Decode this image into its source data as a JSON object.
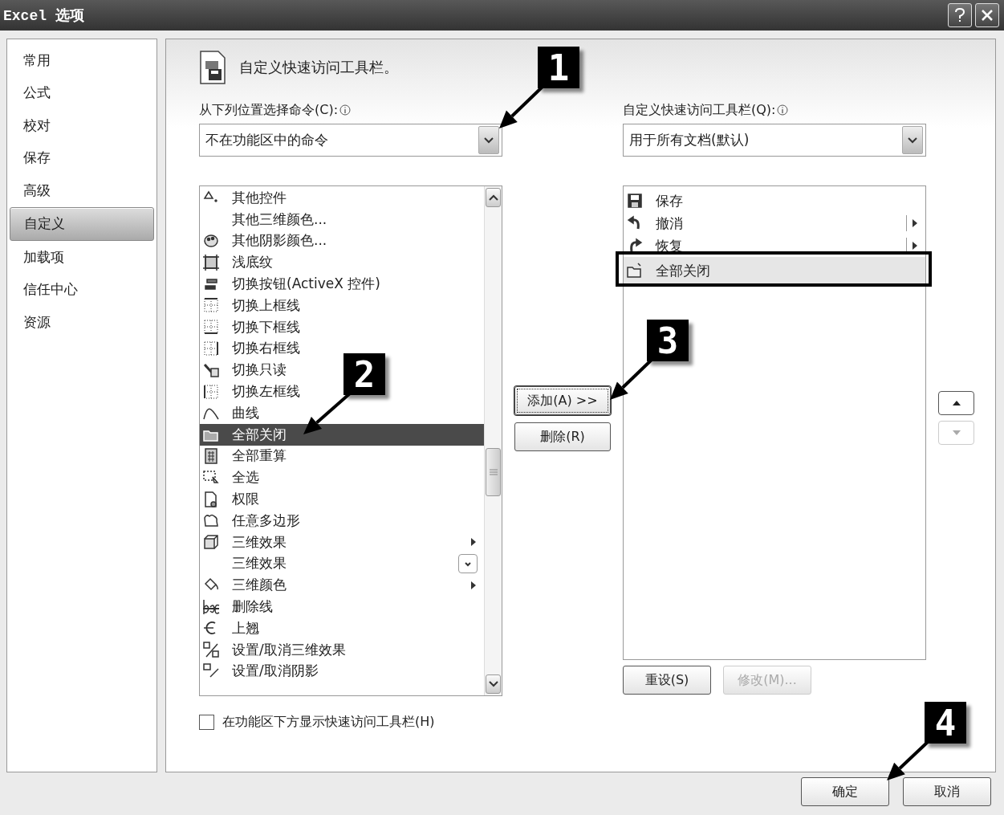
{
  "window": {
    "title": "Excel 选项"
  },
  "sidebar": {
    "items": [
      {
        "label": "常用",
        "selected": false
      },
      {
        "label": "公式",
        "selected": false
      },
      {
        "label": "校对",
        "selected": false
      },
      {
        "label": "保存",
        "selected": false
      },
      {
        "label": "高级",
        "selected": false
      },
      {
        "label": "自定义",
        "selected": true
      },
      {
        "label": "加载项",
        "selected": false
      },
      {
        "label": "信任中心",
        "selected": false
      },
      {
        "label": "资源",
        "selected": false
      }
    ]
  },
  "header": {
    "title": "自定义快速访问工具栏。"
  },
  "commands_source": {
    "label": "从下列位置选择命令(C):",
    "value": "不在功能区中的命令"
  },
  "commands": [
    {
      "label": "其他控件",
      "kind": "plain",
      "selected": false
    },
    {
      "label": "其他三维颜色...",
      "kind": "plain",
      "selected": false
    },
    {
      "label": "其他阴影颜色...",
      "kind": "plain",
      "selected": false
    },
    {
      "label": "浅底纹",
      "kind": "plain",
      "selected": false
    },
    {
      "label": "切换按钮(ActiveX 控件)",
      "kind": "plain",
      "selected": false
    },
    {
      "label": "切换上框线",
      "kind": "plain",
      "selected": false
    },
    {
      "label": "切换下框线",
      "kind": "plain",
      "selected": false
    },
    {
      "label": "切换右框线",
      "kind": "plain",
      "selected": false
    },
    {
      "label": "切换只读",
      "kind": "plain",
      "selected": false
    },
    {
      "label": "切换左框线",
      "kind": "plain",
      "selected": false
    },
    {
      "label": "曲线",
      "kind": "plain",
      "selected": false
    },
    {
      "label": "全部关闭",
      "kind": "plain",
      "selected": true
    },
    {
      "label": "全部重算",
      "kind": "plain",
      "selected": false
    },
    {
      "label": "全选",
      "kind": "plain",
      "selected": false
    },
    {
      "label": "权限",
      "kind": "plain",
      "selected": false
    },
    {
      "label": "任意多边形",
      "kind": "plain",
      "selected": false
    },
    {
      "label": "三维效果",
      "kind": "submenu",
      "selected": false
    },
    {
      "label": "三维效果",
      "kind": "dropdown",
      "selected": false
    },
    {
      "label": "三维颜色",
      "kind": "submenu",
      "selected": false
    },
    {
      "label": "删除线",
      "kind": "plain",
      "selected": false
    },
    {
      "label": "上翘",
      "kind": "plain",
      "selected": false
    },
    {
      "label": "设置/取消三维效果",
      "kind": "plain",
      "selected": false
    },
    {
      "label": "设置/取消阴影",
      "kind": "plain",
      "selected": false
    }
  ],
  "show_below": {
    "label": "在功能区下方显示快速访问工具栏(H)",
    "checked": false
  },
  "middle_buttons": [
    {
      "label": "添加(A) >>",
      "focused": true
    },
    {
      "label": "删除(R)",
      "focused": false
    }
  ],
  "toolbar_target": {
    "label": "自定义快速访问工具栏(Q):",
    "value": "用于所有文档(默认)"
  },
  "toolbar_items": [
    {
      "label": "保存",
      "kind": "plain",
      "selected": false
    },
    {
      "label": "撤消",
      "kind": "submenu",
      "selected": false
    },
    {
      "label": "恢复",
      "kind": "submenu",
      "selected": false
    },
    {
      "label": "全部关闭",
      "kind": "plain",
      "selected": true
    }
  ],
  "list_buttons": [
    {
      "label": "重设(S)",
      "disabled": false
    },
    {
      "label": "修改(M)...",
      "disabled": true
    }
  ],
  "move_buttons": [
    {
      "kind": "up",
      "disabled": false
    },
    {
      "kind": "down",
      "disabled": true
    }
  ],
  "footer_buttons": [
    {
      "label": "确定"
    },
    {
      "label": "取消"
    }
  ],
  "callouts": [
    {
      "number": "1"
    },
    {
      "number": "2"
    },
    {
      "number": "3"
    },
    {
      "number": "4"
    }
  ]
}
